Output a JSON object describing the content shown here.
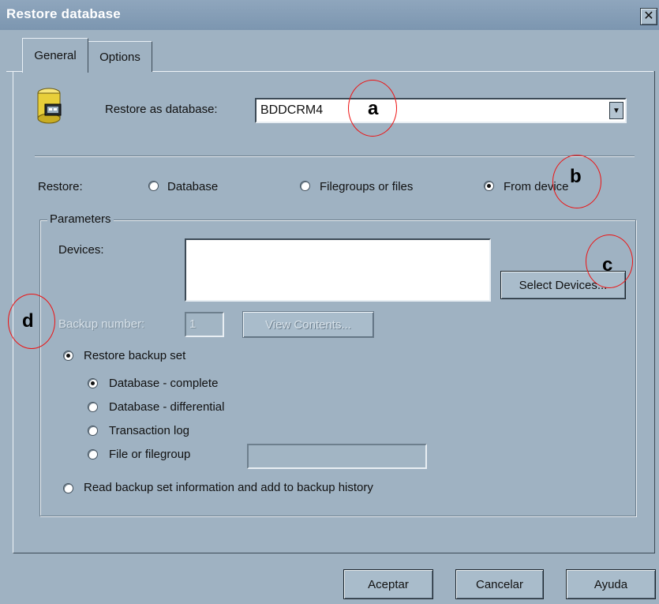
{
  "window": {
    "title": "Restore database",
    "close_glyph": "✕"
  },
  "tabs": [
    {
      "label": "General",
      "active": true
    },
    {
      "label": "Options",
      "active": false
    }
  ],
  "restore_as": {
    "label": "Restore as database:",
    "value": "BDDCRM4",
    "icon": "database-restore-icon"
  },
  "restore": {
    "label": "Restore:",
    "options": [
      {
        "label": "Database",
        "checked": false
      },
      {
        "label": "Filegroups or files",
        "checked": false
      },
      {
        "label": "From device",
        "checked": true
      }
    ]
  },
  "parameters": {
    "legend": "Parameters",
    "devices_label": "Devices:",
    "select_devices_button": "Select Devices...",
    "backup_number_label": "Backup number:",
    "backup_number_value": "1",
    "view_contents_button": "View Contents...",
    "restore_backup_set": {
      "label": "Restore backup set",
      "checked": true
    },
    "backup_types": [
      {
        "label": "Database - complete",
        "checked": true
      },
      {
        "label": "Database - differential",
        "checked": false
      },
      {
        "label": "Transaction log",
        "checked": false
      },
      {
        "label": "File or filegroup",
        "checked": false
      }
    ],
    "read_backup_info": {
      "label": "Read backup set information and add to backup history",
      "checked": false
    }
  },
  "footer": {
    "ok_button": "Aceptar",
    "cancel_button": "Cancelar",
    "help_button": "Ayuda"
  },
  "annotations": {
    "a": "a",
    "b": "b",
    "c": "c",
    "d": "d",
    "color": "#e11111"
  },
  "colors": {
    "dialog_bg": "#9fb2c2",
    "titlebar": "#7c96b0"
  }
}
